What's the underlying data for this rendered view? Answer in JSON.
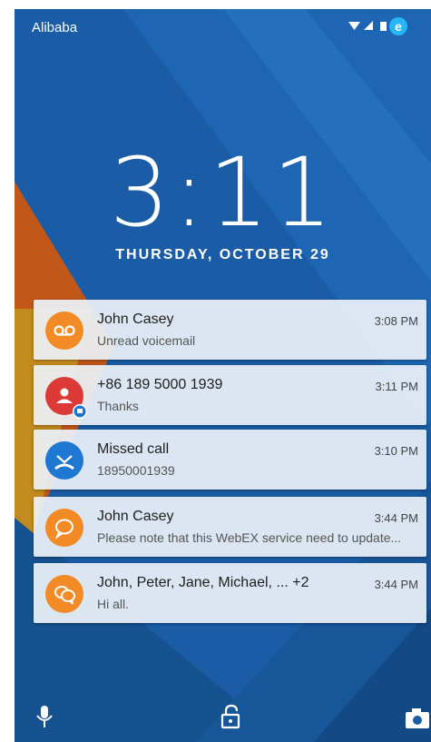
{
  "status_bar": {
    "carrier": "Alibaba",
    "icons": [
      "wifi-icon",
      "signal-icon",
      "battery-icon",
      "browser-icon"
    ]
  },
  "lockscreen": {
    "time": "3:11",
    "date": "THURSDAY, OCTOBER 29"
  },
  "notifications": [
    {
      "title": "John Casey",
      "subtitle": "Unread voicemail",
      "time": "3:08 PM",
      "icon": "voicemail-icon",
      "color": "#f28a25"
    },
    {
      "title": "+86 189 5000 1939",
      "subtitle": "Thanks",
      "time": "3:11 PM",
      "icon": "contact-icon",
      "color": "#dc3a36"
    },
    {
      "title": "Missed call",
      "subtitle": "18950001939",
      "time": "3:10 PM",
      "icon": "missed-call-icon",
      "color": "#1e78d2"
    },
    {
      "title": "John Casey",
      "subtitle": "Please note that this WebEX service need to update...",
      "time": "3:44 PM",
      "icon": "chat-bubble-icon",
      "color": "#f28a25"
    },
    {
      "title": "John, Peter, Jane, Michael, ... +2",
      "subtitle": "Hi all.",
      "time": "3:44 PM",
      "icon": "group-chat-icon",
      "color": "#f28a25"
    }
  ],
  "bottom_bar": {
    "icons": [
      "microphone-icon",
      "unlock-icon",
      "camera-icon"
    ]
  },
  "colors": {
    "background_blue": "#1a5da6",
    "accent_orange": "#f28a25",
    "accent_red": "#dc3a36",
    "accent_blue": "#1e78d2"
  }
}
